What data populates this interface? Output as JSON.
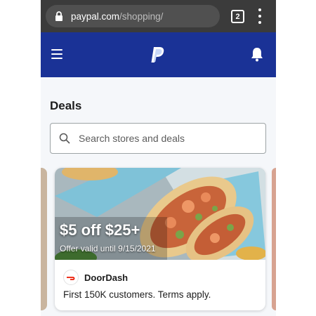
{
  "browser": {
    "url_domain": "paypal.com",
    "url_path": "/shopping/",
    "tab_count": "2"
  },
  "header": {
    "menu_icon": "hamburger-menu-icon",
    "logo": "paypal-logo",
    "notifications_icon": "bell-icon",
    "brand_color": "#1a3296"
  },
  "deals": {
    "title": "Deals",
    "search_placeholder": "Search stores and deals"
  },
  "card": {
    "offer": "$5 off $25+",
    "valid": "Offer valid until 9/15/2021",
    "merchant": "DoorDash",
    "terms": "First 150K customers. Terms apply."
  }
}
